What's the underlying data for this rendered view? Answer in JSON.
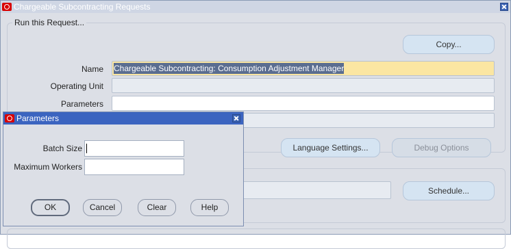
{
  "main_window": {
    "title": "Chargeable Subcontracting Requests",
    "run_group_label": "Run this Request...",
    "copy_button": "Copy...",
    "name_label": "Name",
    "name_value": "Chargeable Subcontracting: Consumption Adjustment Manager",
    "operating_unit_label": "Operating Unit",
    "operating_unit_value": "",
    "parameters_label": "Parameters",
    "parameters_value": "",
    "language_settings_button": "Language Settings...",
    "debug_options_button": "Debug Options",
    "schedule_button": "Schedule..."
  },
  "parameters_dialog": {
    "title": "Parameters",
    "batch_size_label": "Batch Size",
    "batch_size_value": "",
    "maximum_workers_label": "Maximum Workers",
    "maximum_workers_value": "",
    "buttons": {
      "ok": "OK",
      "cancel": "Cancel",
      "clear": "Clear",
      "help": "Help"
    }
  },
  "colors": {
    "window_background": "#dcdfe6",
    "dialog_titlebar": "#3b64c0",
    "name_field_highlight": "#fbe6a2",
    "button_fill": "#d5e4f2"
  },
  "icons": [
    "oracle-logo-icon",
    "close-icon"
  ]
}
